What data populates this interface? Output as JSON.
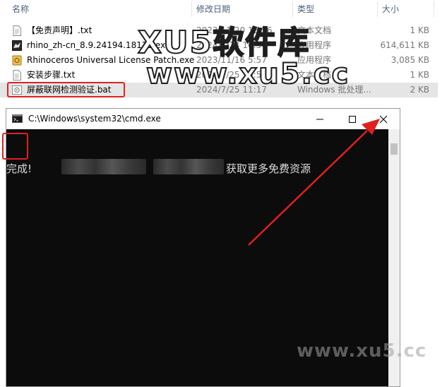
{
  "explorer": {
    "columns": {
      "name": "名称",
      "date": "修改日期",
      "type": "类型",
      "size": "大小"
    },
    "files": [
      {
        "name": "【免责声明】.txt",
        "date": "2023/11/20 15:56",
        "type": "文本文档",
        "size": "1 KB",
        "icon": "text-file-icon"
      },
      {
        "name": "rhino_zh-cn_8.9.24194.18121.exe",
        "date": "2024/7/24 10:54",
        "type": "应用程序",
        "size": "614,611 KB",
        "icon": "rhino-exe-icon"
      },
      {
        "name": "Rhinoceros Universal License Patch.exe",
        "date": "2023/11/16 5:57",
        "type": "应用程序",
        "size": "3,085 KB",
        "icon": "patch-exe-icon"
      },
      {
        "name": "安装步骤.txt",
        "date": "2024/7/25 10:52",
        "type": "文本文档",
        "size": "1 KB",
        "icon": "text-file-icon"
      },
      {
        "name": "屏蔽联网检测验证.bat",
        "date": "2024/7/25 11:17",
        "type": "Windows 批处理...",
        "size": "2 KB",
        "icon": "bat-file-icon"
      }
    ]
  },
  "cmd": {
    "title": "C:\\Windows\\system32\\cmd.exe",
    "output_done": "完成!",
    "output_tail": "获取更多免费资源"
  },
  "watermark": {
    "line1": "XU5软件库",
    "line2": "www.xu5.cc",
    "line3": "www.xu5.cc"
  },
  "colors": {
    "highlight": "#e02020",
    "console_bg": "#0c0c0c",
    "selected_row": "#e5e5e5"
  }
}
